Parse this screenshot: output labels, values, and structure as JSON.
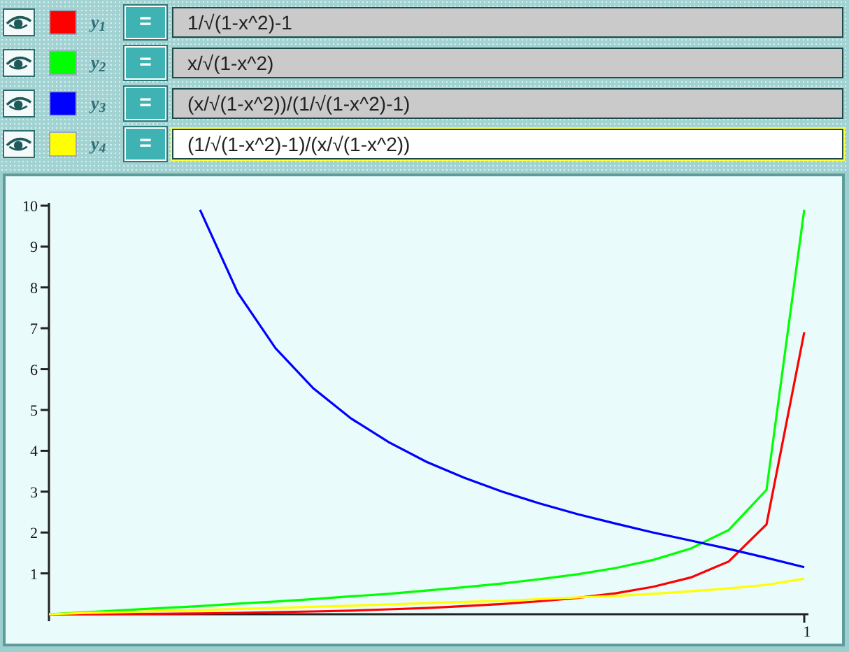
{
  "functions": [
    {
      "color": "#ff0000",
      "label": "y$_{1}$",
      "button": "=",
      "formula": "1/√(1-x^2)-1",
      "selected": false
    },
    {
      "color": "#00ff00",
      "label": "y$_{2}$",
      "button": "=",
      "formula": "x/√(1-x^2)",
      "selected": false
    },
    {
      "color": "#0000ff",
      "label": "y$_{3}$",
      "button": "=",
      "formula": "(x/√(1-x^2))/(1/√(1-x^2)-1)",
      "selected": false
    },
    {
      "color": "#ffff00",
      "label": "y$_{4}$",
      "button": "=",
      "formula": "(1/√(1-x^2)-1)/(x/√(1-x^2))",
      "selected": true
    }
  ],
  "graph": {
    "chart_data": {
      "type": "line",
      "ylim": [
        0,
        10
      ],
      "yticks": [
        {
          "value": 1,
          "label": "1"
        },
        {
          "value": 2,
          "label": "2"
        },
        {
          "value": 3,
          "label": "3"
        },
        {
          "value": 4,
          "label": "4"
        },
        {
          "value": 5,
          "label": "5"
        },
        {
          "value": 6,
          "label": "6"
        },
        {
          "value": 7,
          "label": "7"
        },
        {
          "value": 8,
          "label": "8"
        },
        {
          "value": 9,
          "label": "9"
        },
        {
          "value": 10,
          "label": "10"
        }
      ],
      "annotations": [
        {
          "text": "1"
        }
      ],
      "series": [
        {
          "color": "#ff0000",
          "values": [
            0,
            0,
            0.01,
            0.01,
            0.02,
            0.03,
            0.05,
            0.07,
            0.09,
            0.12,
            0.15,
            0.2,
            0.25,
            0.32,
            0.4,
            0.51,
            0.67,
            0.9,
            1.29,
            2.2,
            6.9
          ]
        },
        {
          "color": "#00ff00",
          "values": [
            0,
            0.05,
            0.1,
            0.15,
            0.2,
            0.26,
            0.31,
            0.37,
            0.44,
            0.5,
            0.58,
            0.66,
            0.75,
            0.86,
            0.98,
            1.13,
            1.33,
            1.61,
            2.06,
            3.04,
            9.9
          ]
        },
        {
          "color": "#0000ff",
          "values": [
            null,
            null,
            null,
            null,
            9.9,
            7.87,
            6.51,
            5.53,
            4.79,
            4.21,
            3.73,
            3.34,
            3,
            2.71,
            2.45,
            2.22,
            2,
            1.8,
            1.6,
            1.38,
            1.15
          ]
        },
        {
          "color": "#ffff00",
          "values": [
            0,
            0.03,
            0.05,
            0.08,
            0.1,
            0.13,
            0.15,
            0.18,
            0.21,
            0.24,
            0.27,
            0.3,
            0.33,
            0.37,
            0.41,
            0.45,
            0.5,
            0.56,
            0.63,
            0.72,
            0.87
          ]
        }
      ]
    }
  }
}
